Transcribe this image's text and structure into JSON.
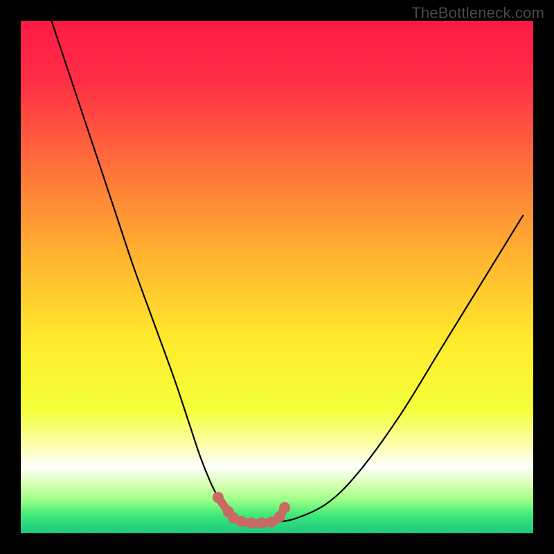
{
  "watermark": "TheBottleneck.com",
  "colors": {
    "black": "#000000",
    "curve": "#000000",
    "marker": "#c66a63",
    "gradient_stops": [
      {
        "offset": 0.0,
        "color": "#ff1a44"
      },
      {
        "offset": 0.12,
        "color": "#ff2f46"
      },
      {
        "offset": 0.28,
        "color": "#ff6f3a"
      },
      {
        "offset": 0.45,
        "color": "#ffb030"
      },
      {
        "offset": 0.62,
        "color": "#ffe92c"
      },
      {
        "offset": 0.76,
        "color": "#f5ff3a"
      },
      {
        "offset": 0.83,
        "color": "#fbffb0"
      },
      {
        "offset": 0.87,
        "color": "#ffffff"
      },
      {
        "offset": 0.905,
        "color": "#d6ffb0"
      },
      {
        "offset": 0.935,
        "color": "#9cff86"
      },
      {
        "offset": 0.965,
        "color": "#3fe87a"
      },
      {
        "offset": 1.0,
        "color": "#18c880"
      }
    ]
  },
  "chart_data": {
    "type": "line",
    "title": "",
    "xlabel": "",
    "ylabel": "",
    "xlim": [
      0,
      100
    ],
    "ylim": [
      0,
      100
    ],
    "series": [
      {
        "name": "bottleneck-curve",
        "x": [
          6,
          10,
          14,
          18,
          22,
          26,
          30,
          33,
          35,
          37,
          38.5,
          40,
          41.5,
          43,
          45,
          47,
          50,
          54,
          60,
          66,
          74,
          82,
          90,
          98
        ],
        "y": [
          100,
          88,
          76,
          64,
          52,
          41,
          30,
          21,
          15,
          10,
          7,
          4.5,
          3,
          2.3,
          2,
          2,
          2.2,
          3,
          6,
          12,
          23,
          36,
          49,
          62
        ]
      }
    ],
    "markers": {
      "name": "highlight-band",
      "x": [
        38.5,
        40.5,
        41.5,
        43,
        45,
        47,
        49,
        50.5,
        51.5
      ],
      "y": [
        7,
        4.2,
        3,
        2.3,
        2,
        2,
        2.2,
        3.2,
        5
      ]
    }
  }
}
